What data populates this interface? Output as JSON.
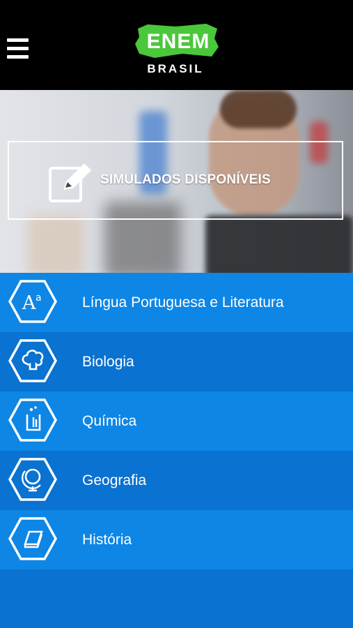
{
  "header": {
    "logo_main": "ENEM",
    "logo_sub": "BRASIL",
    "brand_color": "#4ac73a"
  },
  "hero": {
    "label": "SIMULADOS DISPONÍVEIS"
  },
  "subjects": [
    {
      "label": "Língua Portuguesa e Literatura",
      "icon": "letters-icon"
    },
    {
      "label": "Biologia",
      "icon": "tree-icon"
    },
    {
      "label": "Química",
      "icon": "flask-icon"
    },
    {
      "label": "Geografia",
      "icon": "globe-icon"
    },
    {
      "label": "História",
      "icon": "book-icon"
    }
  ],
  "colors": {
    "header_bg": "#000000",
    "item_light": "#0d86e5",
    "item_dark": "#0a72d0"
  }
}
